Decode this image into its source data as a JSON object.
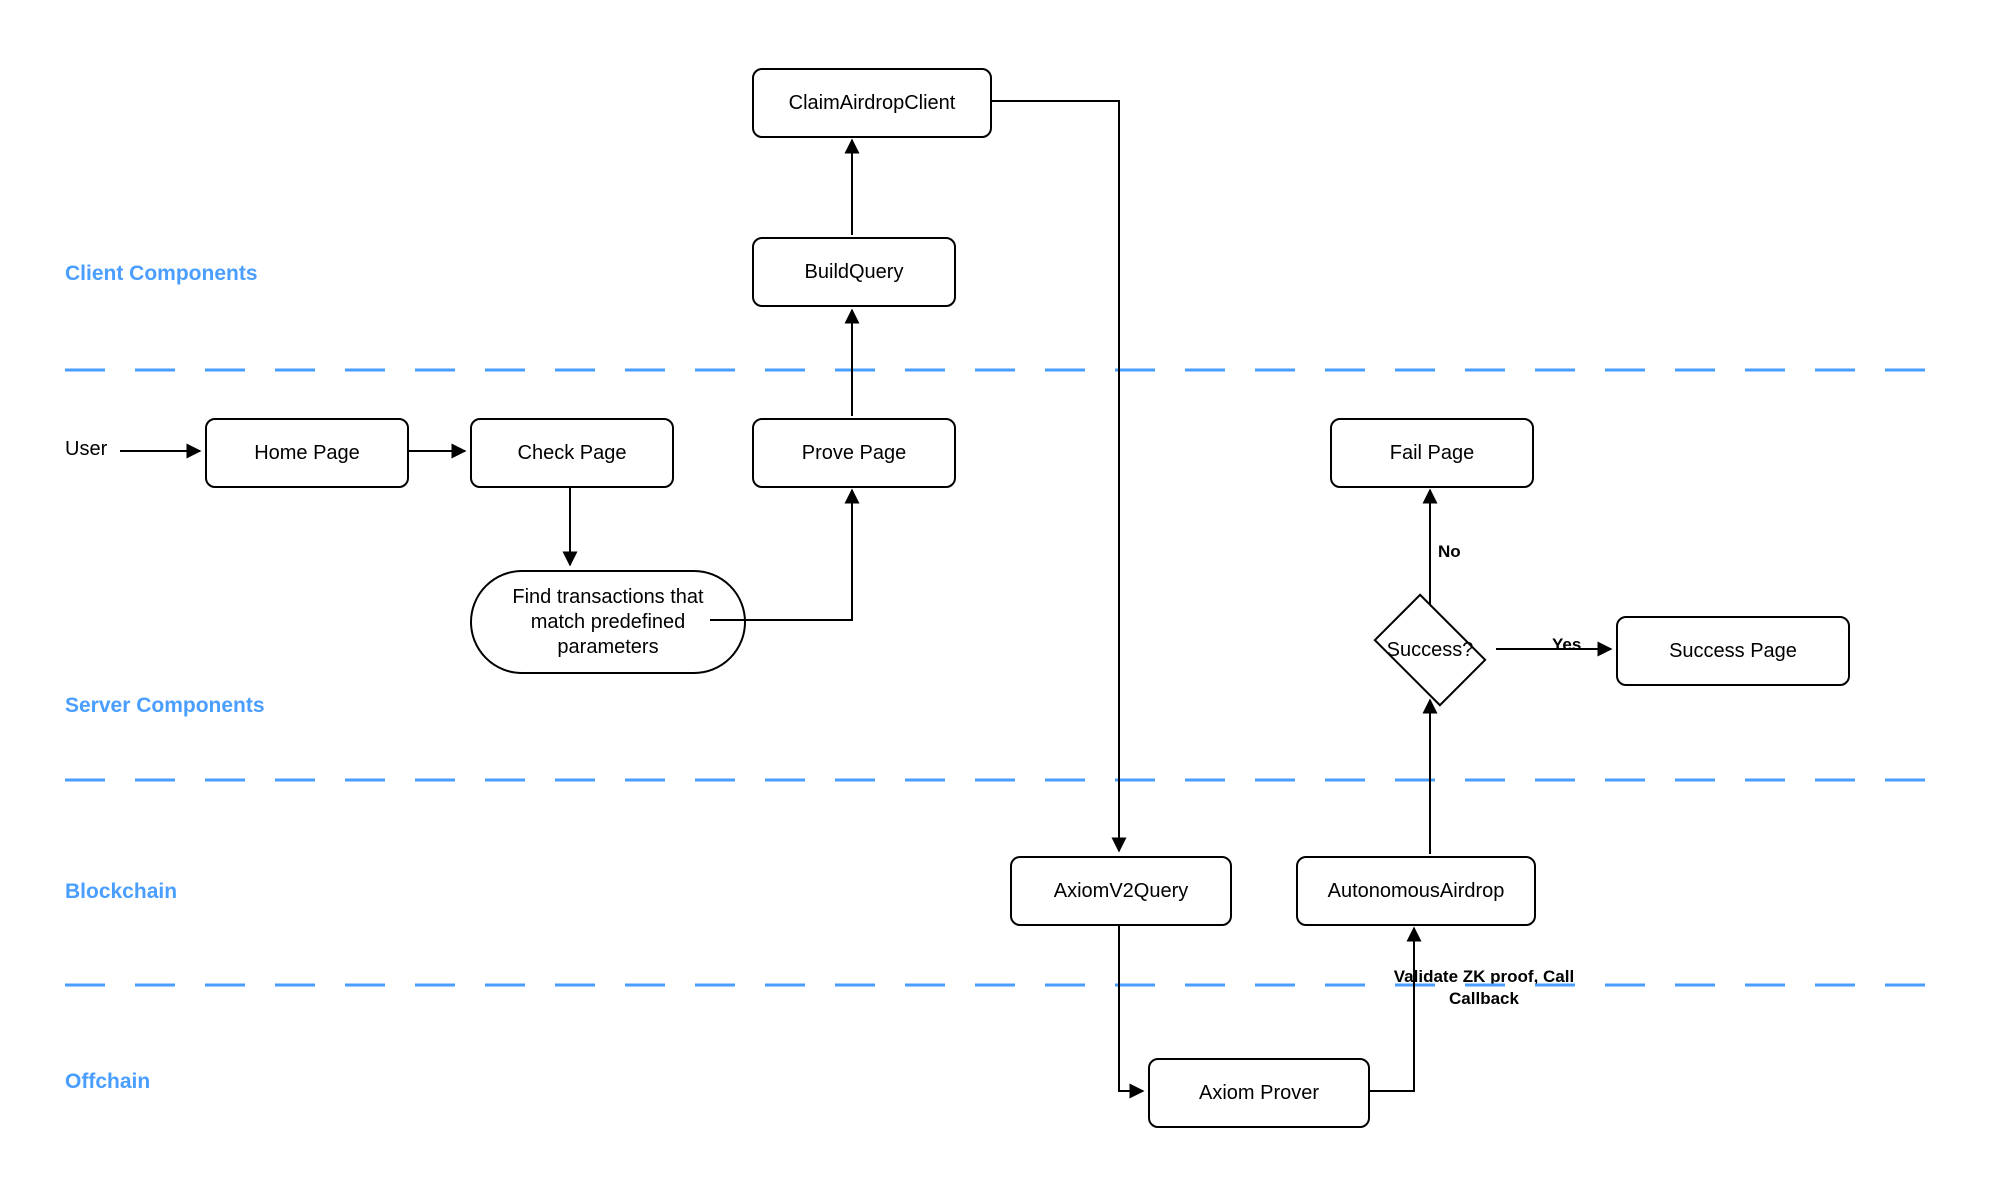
{
  "lanes": {
    "client": "Client Components",
    "server": "Server Components",
    "blockchain": "Blockchain",
    "offchain": "Offchain"
  },
  "nodes": {
    "user": "User",
    "home_page": "Home Page",
    "check_page": "Check Page",
    "prove_page": "Prove Page",
    "build_query": "BuildQuery",
    "claim_client": "ClaimAirdropClient",
    "find_tx": "Find transactions that match predefined parameters",
    "axiom_v2_query": "AxiomV2Query",
    "axiom_prover": "Axiom Prover",
    "autonomous_airdrop": "AutonomousAirdrop",
    "fail_page": "Fail Page",
    "success_page": "Success Page",
    "decision": "Success?"
  },
  "edges": {
    "validate_zk": "Validate ZK proof, Call Callback",
    "yes": "Yes",
    "no": "No"
  }
}
